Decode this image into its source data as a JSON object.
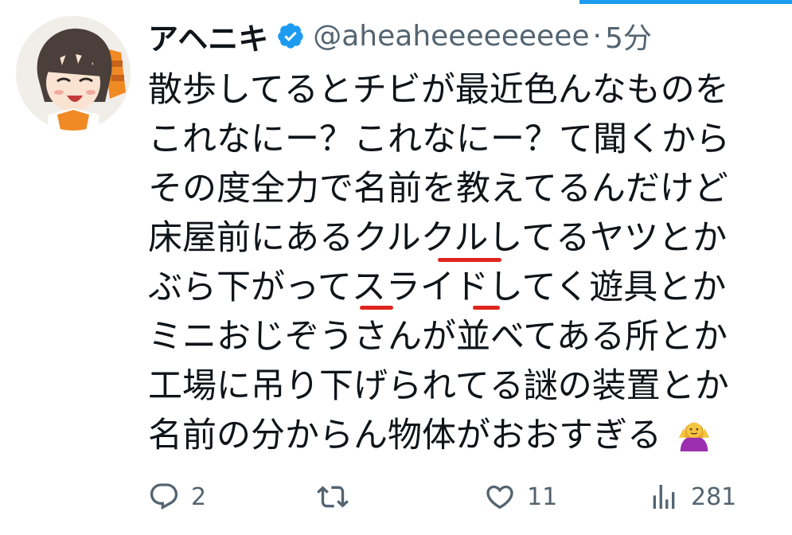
{
  "tweet": {
    "author_name": "アヘニキ",
    "verified": true,
    "handle": "@aheaheeeeeeeee",
    "separator": "·",
    "time": "5分",
    "lines": [
      "散歩してるとチビが最近色んなものを",
      "これなにー？これなにー？て聞くから",
      "その度全力で名前を教えてるんだけど",
      "床屋前にあるクルクルしてるヤツとか",
      "ぶら下がってスライドしてく遊具とか",
      "ミニおじぞうさんが並べてある所とか",
      "工場に吊り下げられてる謎の装置とか",
      "名前の分からん物体がおおすぎる"
    ],
    "emoji": "person-shrugging-emoji"
  },
  "actions": {
    "reply_count": "2",
    "retweet_count": "",
    "like_count": "11",
    "views_count": "281"
  },
  "colors": {
    "accent": "#1d9bf0",
    "text": "#0f1419",
    "muted": "#536471",
    "annotation": "#e0241e"
  }
}
